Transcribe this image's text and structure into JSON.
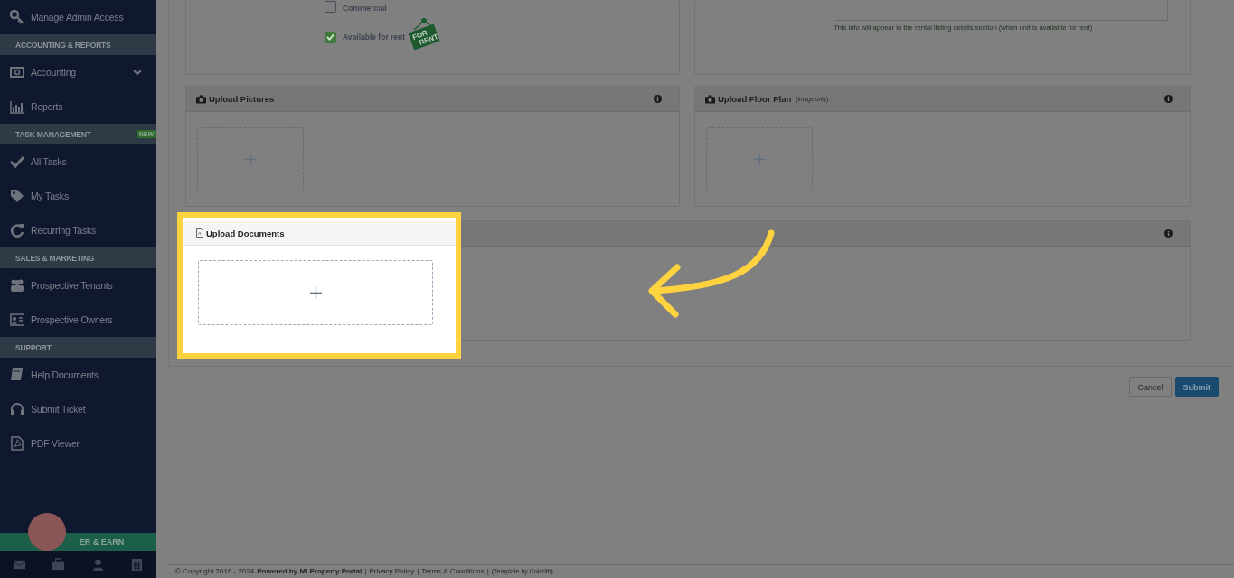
{
  "sidebar": {
    "items": [
      {
        "kind": "link",
        "label": "Manage Admin Access"
      },
      {
        "kind": "section",
        "label": "ACCOUNTING & REPORTS"
      },
      {
        "kind": "link",
        "label": "Accounting",
        "expanded": false
      },
      {
        "kind": "link",
        "label": "Reports"
      },
      {
        "kind": "section",
        "label": "TASK MANAGEMENT",
        "badge": "NEW"
      },
      {
        "kind": "link",
        "label": "All Tasks"
      },
      {
        "kind": "link",
        "label": "My Tasks"
      },
      {
        "kind": "link",
        "label": "Recurring Tasks"
      },
      {
        "kind": "section",
        "label": "SALES & MARKETING"
      },
      {
        "kind": "link",
        "label": "Prospective Tenants"
      },
      {
        "kind": "link",
        "label": "Prospective Owners"
      },
      {
        "kind": "section",
        "label": "SUPPORT"
      },
      {
        "kind": "link",
        "label": "Help Documents"
      },
      {
        "kind": "link",
        "label": "Submit Ticket"
      },
      {
        "kind": "link",
        "label": "PDF Viewer"
      }
    ],
    "referral_banner": "ER & EARN"
  },
  "property_form": {
    "checkboxes": [
      {
        "label": "Commercial",
        "checked": false
      },
      {
        "label": "Available for rent",
        "checked": true
      }
    ],
    "sign_text": [
      "FOR",
      "RENT"
    ],
    "listing_hint": "This info will appear in the rental listing details section (when unit is available for rent)",
    "upload_pictures": {
      "title": "Upload Pictures"
    },
    "upload_floor_plan": {
      "title": "Upload Floor Plan",
      "note": "(image only)"
    },
    "upload_documents": {
      "title": "Upload Documents",
      "highlighted": true
    }
  },
  "buttons": [
    {
      "label": "Cancel",
      "kind": "secondary"
    },
    {
      "label": "Submit",
      "kind": "primary"
    }
  ],
  "footer": [
    {
      "kind": "text",
      "text": "© Copyright 2016 - 2024"
    },
    {
      "kind": "bold",
      "text": "Powered by MI Property Portal"
    },
    {
      "kind": "sep",
      "text": "|"
    },
    {
      "kind": "link",
      "text": "Privacy Policy"
    },
    {
      "kind": "sep",
      "text": "|"
    },
    {
      "kind": "link",
      "text": "Terms & Conditions"
    },
    {
      "kind": "sep",
      "text": "|"
    },
    {
      "kind": "small",
      "text": "(Template by Colorlib)"
    }
  ]
}
